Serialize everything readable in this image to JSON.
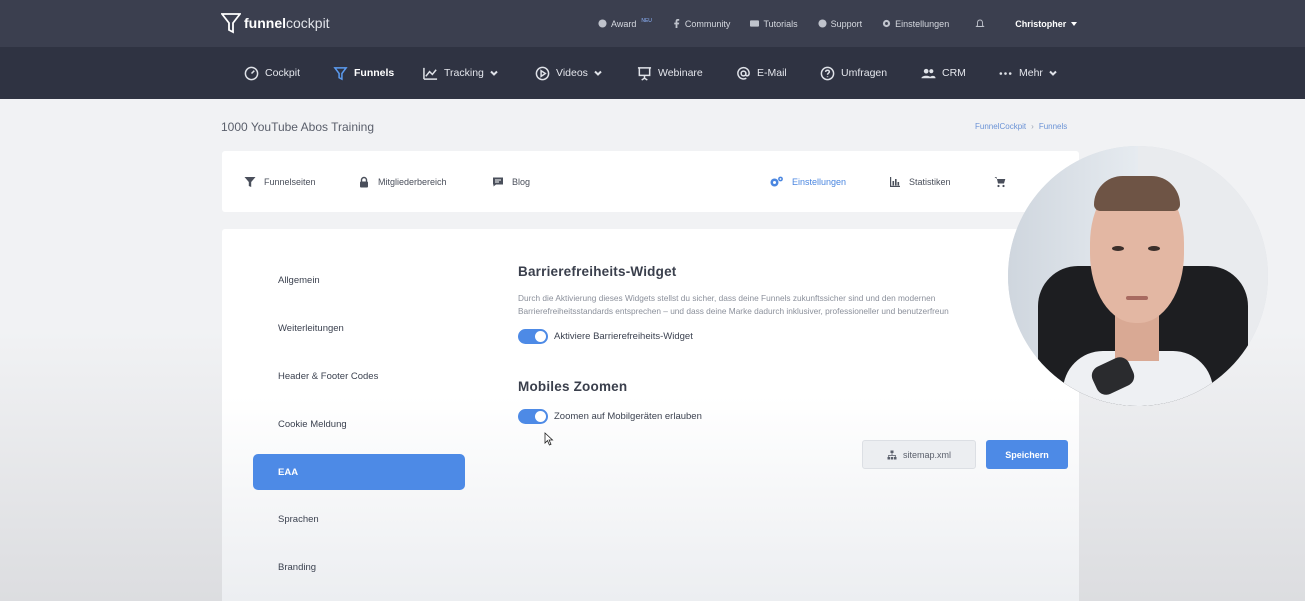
{
  "logo": {
    "bold": "funnel",
    "light": "cockpit"
  },
  "topbar": {
    "links": [
      {
        "label": "Award",
        "sup": "NEU",
        "icon": "award-icon"
      },
      {
        "label": "Community",
        "icon": "facebook-icon"
      },
      {
        "label": "Tutorials",
        "icon": "film-icon"
      },
      {
        "label": "Support",
        "icon": "globe-icon"
      },
      {
        "label": "Einstellungen",
        "icon": "gear-icon"
      }
    ],
    "user": "Christopher"
  },
  "nav": [
    {
      "label": "Cockpit",
      "icon": "gauge-icon"
    },
    {
      "label": "Funnels",
      "icon": "funnel-icon",
      "active": true
    },
    {
      "label": "Tracking",
      "icon": "chart-line-icon"
    },
    {
      "label": "Videos",
      "icon": "play-circle-icon"
    },
    {
      "label": "Webinare",
      "icon": "presentation-icon"
    },
    {
      "label": "E-Mail",
      "icon": "at-icon"
    },
    {
      "label": "Umfragen",
      "icon": "question-circle-icon"
    },
    {
      "label": "CRM",
      "icon": "users-icon"
    },
    {
      "label": "Mehr",
      "icon": "dots-icon"
    }
  ],
  "page": {
    "title": "1000 YouTube Abos Training",
    "breadcrumb": [
      "FunnelCockpit",
      "Funnels"
    ]
  },
  "tabs": [
    {
      "label": "Funnelseiten",
      "icon": "funnel-icon"
    },
    {
      "label": "Mitgliederbereich",
      "icon": "lock-icon"
    },
    {
      "label": "Blog",
      "icon": "blog-icon"
    },
    {
      "label": "Einstellungen",
      "icon": "gears-icon",
      "active": true
    },
    {
      "label": "Statistiken",
      "icon": "bar-chart-icon"
    }
  ],
  "sidebar": {
    "items": [
      {
        "label": "Allgemein"
      },
      {
        "label": "Weiterleitungen"
      },
      {
        "label": "Header & Footer Codes"
      },
      {
        "label": "Cookie Meldung"
      },
      {
        "label": "EAA",
        "active": true
      },
      {
        "label": "Sprachen"
      },
      {
        "label": "Branding"
      }
    ]
  },
  "widget": {
    "title": "Barrierefreiheits-Widget",
    "description": "Durch die Aktivierung dieses Widgets stellst du sicher, dass deine Funnels zukunftssicher sind und den modernen Barrierefreiheitsstandards entsprechen – und dass deine Marke dadurch inklusiver, professioneller und benutzerfreun",
    "toggle_label": "Aktiviere Barrierefreiheits-Widget"
  },
  "zoom": {
    "title": "Mobiles Zoomen",
    "toggle_label": "Zoomen auf Mobilgeräten erlauben"
  },
  "buttons": {
    "sitemap": "sitemap.xml",
    "save": "Speichern"
  },
  "colors": {
    "accent": "#4d8ae6",
    "topbar": "#3b3f4f",
    "nav": "#2f3342"
  }
}
